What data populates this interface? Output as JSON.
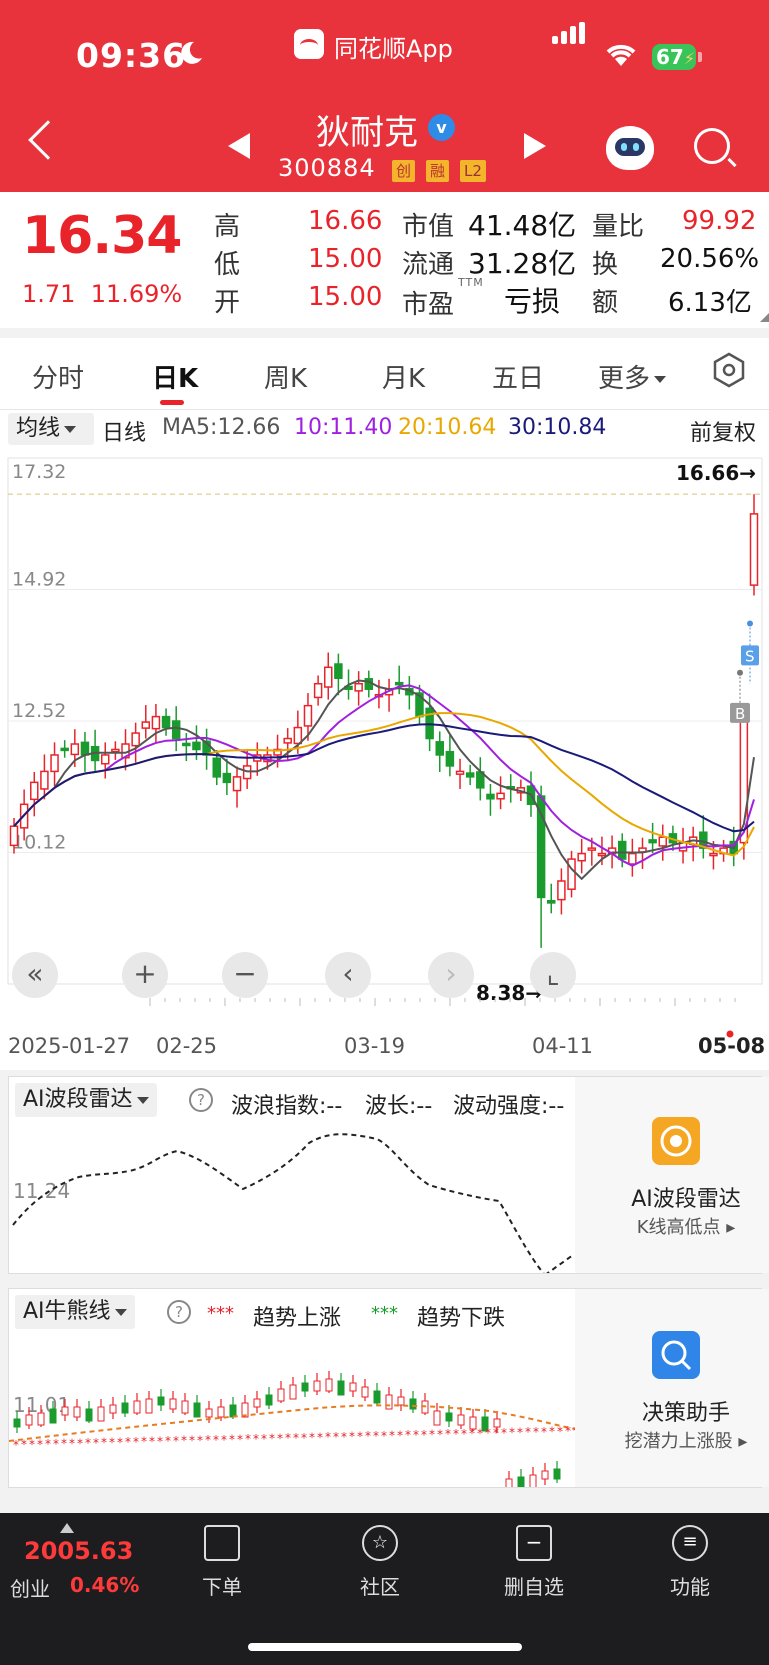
{
  "status": {
    "time": "09:36",
    "app": "同花顺App",
    "battery": "67"
  },
  "stock": {
    "name": "狄耐克",
    "code": "300884",
    "tags": [
      "创",
      "融",
      "L2"
    ]
  },
  "quote": {
    "price": "16.34",
    "change": "1.71",
    "change_pct": "11.69%",
    "rows": [
      {
        "l1": "高",
        "v1": "16.66",
        "l2": "市值",
        "v2": "41.48亿",
        "l3": "量比",
        "v3": "99.92"
      },
      {
        "l1": "低",
        "v1": "15.00",
        "l2": "流通",
        "v2": "31.28亿",
        "l3": "换",
        "v3": "20.56%"
      },
      {
        "l1": "开",
        "v1": "15.00",
        "l2": "市盈",
        "v2": "亏损",
        "l3": "额",
        "v3": "6.13亿"
      }
    ],
    "ttm": "TTM"
  },
  "tabs": [
    "分时",
    "日K",
    "周K",
    "月K",
    "五日",
    "更多"
  ],
  "ma": {
    "selector": "均线",
    "period": "日线",
    "ma5": "MA5:12.66",
    "ma10": "10:11.40",
    "ma20": "20:10.64",
    "ma30": "30:10.84",
    "adjust": "前复权"
  },
  "colors": {
    "up": "#e8232a",
    "down": "#1a9b2e",
    "ma5": "#555555",
    "ma10": "#a020e0",
    "ma20": "#e8a800",
    "ma30": "#1a1a7a"
  },
  "chart_data": {
    "type": "candlestick",
    "y_ticks": [
      "17.32",
      "14.92",
      "12.52",
      "10.12",
      "7.72"
    ],
    "ylim": [
      7.72,
      17.32
    ],
    "high_label": "16.66→",
    "low_label": "8.38→",
    "x_labels": [
      "2025-01-27",
      "02-25",
      "03-19",
      "04-11",
      "05-08"
    ],
    "markers": [
      "S",
      "B"
    ]
  },
  "controls": [
    "«",
    "+",
    "−",
    "‹",
    "›",
    "⌞"
  ],
  "radar": {
    "selector": "AI波段雷达",
    "t1": "波浪指数:--",
    "t2": "波长:--",
    "t3": "波动强度:--",
    "y_tick": "11.24",
    "side_title": "AI波段雷达",
    "side_sub": "K线高低点 ▸"
  },
  "bull": {
    "selector": "AI牛熊线",
    "legend_up": "趋势上涨",
    "legend_down": "趋势下跌",
    "y_tick": "11.01",
    "side_title": "决策助手",
    "side_sub": "挖潜力上涨股 ▸"
  },
  "bottom": {
    "index_value": "2005.63",
    "index_name": "创业",
    "index_pct": "0.46%",
    "nav": [
      "下单",
      "社区",
      "删自选",
      "功能"
    ]
  }
}
